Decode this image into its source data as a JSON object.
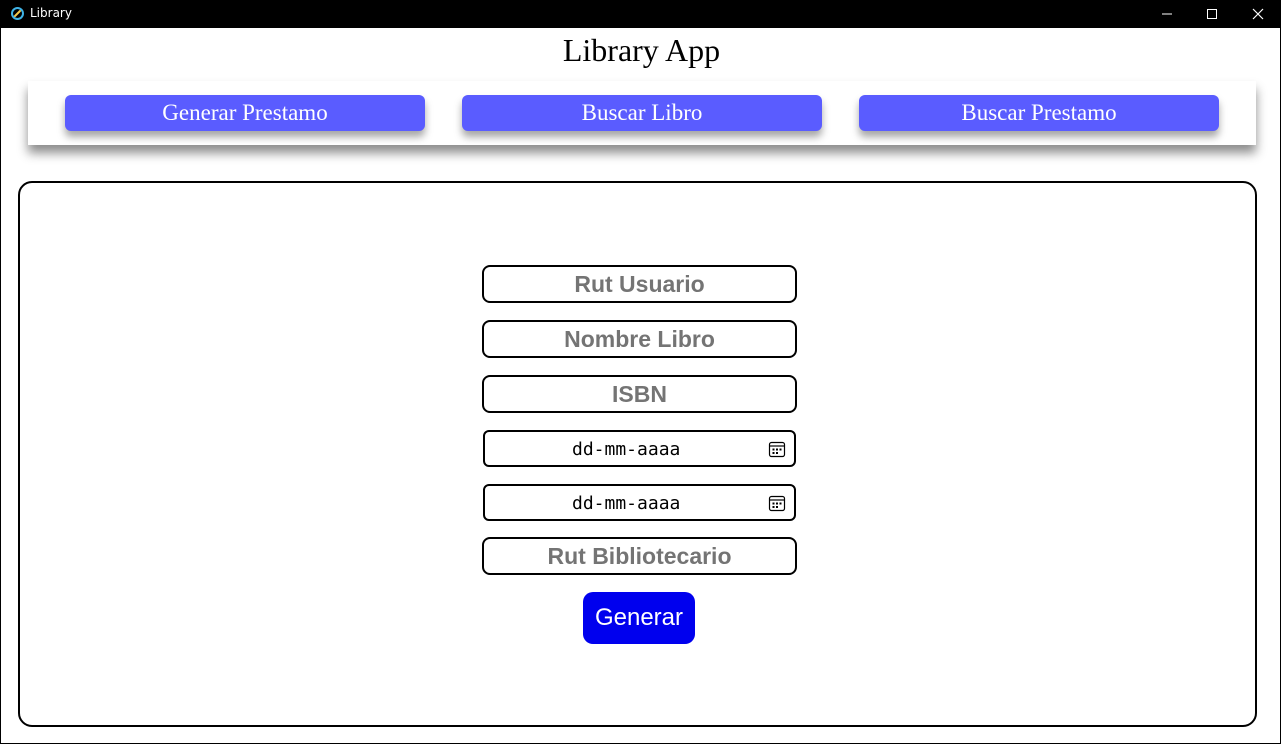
{
  "window": {
    "title": "Library",
    "controls": {
      "minimize": "minimize-icon",
      "maximize": "maximize-icon",
      "close": "close-icon"
    }
  },
  "app": {
    "title": "Library App"
  },
  "nav": {
    "items": [
      {
        "label": "Generar Prestamo"
      },
      {
        "label": "Buscar Libro"
      },
      {
        "label": "Buscar Prestamo"
      }
    ]
  },
  "form": {
    "rut_usuario": {
      "placeholder": "Rut Usuario"
    },
    "nombre_libro": {
      "placeholder": "Nombre Libro"
    },
    "isbn": {
      "placeholder": "ISBN"
    },
    "fecha_1": {
      "value": "dd-mm-aaaa",
      "icon": "calendar-icon"
    },
    "fecha_2": {
      "value": "dd-mm-aaaa",
      "icon": "calendar-icon"
    },
    "rut_bibliotecario": {
      "placeholder": "Rut Bibliotecario"
    },
    "submit_label": "Generar"
  },
  "colors": {
    "nav_button": "#5a5cff",
    "submit_button": "#0000ee",
    "placeholder_text": "#747474",
    "titlebar": "#000000"
  }
}
